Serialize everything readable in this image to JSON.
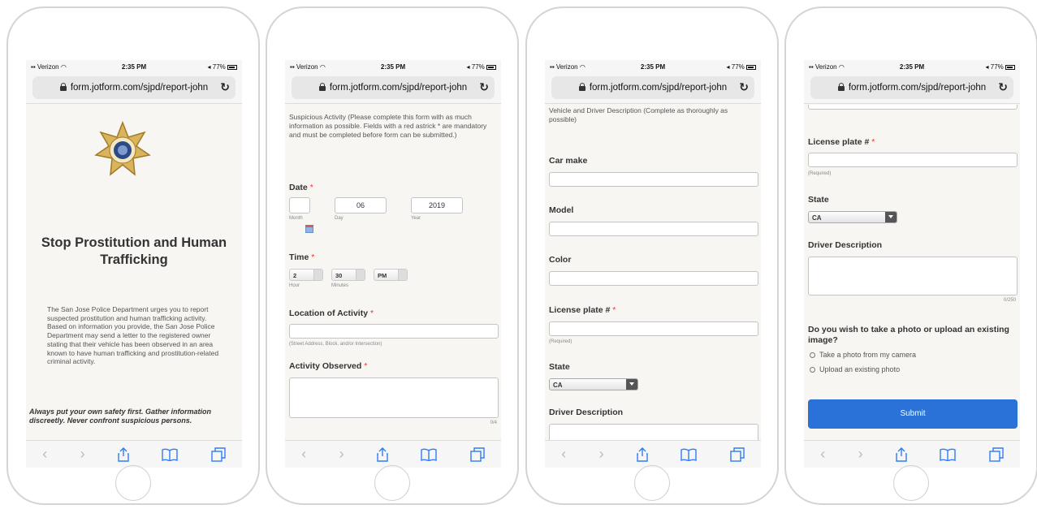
{
  "status": {
    "carrier": "Verizon",
    "time": "2:35 PM",
    "battery": "77%"
  },
  "url": "form.jotform.com/sjpd/report-john",
  "screen1": {
    "title": "Stop Prostitution and Human Trafficking",
    "intro": "The San Jose Police Department urges you to report suspected prostitution and human trafficking activity. Based on information you provide, the San Jose Police Department may send a letter to the registered owner stating that their vehicle has been observed in an area known to have human trafficking and prostitution-related criminal activity.",
    "safety": "Always put your own safety first. Gather information discreetly. Never confront suspicious persons."
  },
  "screen2": {
    "intro": "Suspicious Activity (Please complete this form with as much information as possible. Fields with a red astrick * are mandatory and must be completed before form can be submitted.)",
    "date_label": "Date",
    "date": {
      "month": "",
      "day": "06",
      "year": "2019",
      "month_sub": "Month",
      "day_sub": "Day",
      "year_sub": "Year"
    },
    "time_label": "Time",
    "time": {
      "hour": "2",
      "minutes": "30",
      "ampm": "PM",
      "hour_sub": "Hour",
      "minutes_sub": "Minutes"
    },
    "location_label": "Location of Activity",
    "location_value": "",
    "location_sub": "(Street Address, Block, and/or Intersection)",
    "activity_label": "Activity Observed",
    "activity_value": "",
    "activity_count": "0/4"
  },
  "screen3": {
    "intro": "Vehicle and Driver Description (Complete as thoroughly as possible)",
    "car_make_label": "Car make",
    "model_label": "Model",
    "color_label": "Color",
    "plate_label": "License plate #",
    "plate_sub": "(Required)",
    "state_label": "State",
    "state_value": "CA",
    "driver_label": "Driver Description"
  },
  "screen4": {
    "plate_label": "License plate #",
    "plate_sub": "(Required)",
    "state_label": "State",
    "state_value": "CA",
    "driver_label": "Driver Description",
    "driver_count": "0/250",
    "photo_question": "Do you wish to take a photo or upload an existing image?",
    "option1": "Take a photo from my camera",
    "option2": "Upload an existing photo",
    "submit_label": "Submit"
  },
  "colors": {
    "accent": "#2e7cf6",
    "required": "#e33333",
    "submit": "#2a72d8"
  },
  "icons": [
    "lock-icon",
    "reload-icon",
    "back-arrow-icon",
    "forward-arrow-icon",
    "share-icon",
    "bookmarks-icon",
    "tabs-icon",
    "calendar-icon"
  ]
}
